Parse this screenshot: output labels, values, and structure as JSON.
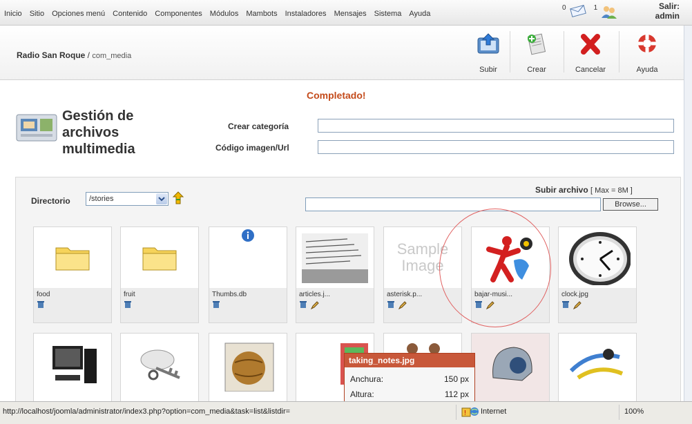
{
  "menu": [
    "Inicio",
    "Sitio",
    "Opciones menú",
    "Contenido",
    "Componentes",
    "Módulos",
    "Mambots",
    "Instaladores",
    "Mensajes",
    "Sistema",
    "Ayuda"
  ],
  "sys": {
    "messages_count": "0",
    "users_count": "1",
    "logout_label": "Salir:",
    "user": "admin"
  },
  "breadcrumb": {
    "site": "Radio San Roque",
    "sep": " / ",
    "component": "com_media"
  },
  "toolbar": {
    "upload": "Subir",
    "create": "Crear",
    "cancel": "Cancelar",
    "help": "Ayuda"
  },
  "message": "Completado!",
  "page": {
    "title_line1": "Gestión de",
    "title_line2": "archivos",
    "title_line3": "multimedia"
  },
  "form": {
    "create_category": "Crear categoría",
    "image_code": "Código imagen/Url",
    "create_category_value": "",
    "image_code_value": ""
  },
  "directory": {
    "label": "Directorio",
    "value": "/stories"
  },
  "upload": {
    "label": "Subir archivo",
    "max": "[ Max = 8M ]",
    "browse": "Browse..."
  },
  "files": [
    {
      "name": "food"
    },
    {
      "name": "fruit"
    },
    {
      "name": "Thumbs.db"
    },
    {
      "name": "articles.j..."
    },
    {
      "name": "asterisk.p..."
    },
    {
      "name": "bajar-musi..."
    },
    {
      "name": "clock.jpg"
    }
  ],
  "sample_image_text": "Sample Image",
  "tooltip": {
    "title": "taking_notes.jpg",
    "width_label": "Anchura:",
    "width_value": "150 px",
    "height_label": "Altura:",
    "height_value": "112 px"
  },
  "status": {
    "url": "http://localhost/joomla/administrator/index3.php?option=com_media&task=list&listdir=",
    "zone": "Internet",
    "zoom": "100%"
  }
}
